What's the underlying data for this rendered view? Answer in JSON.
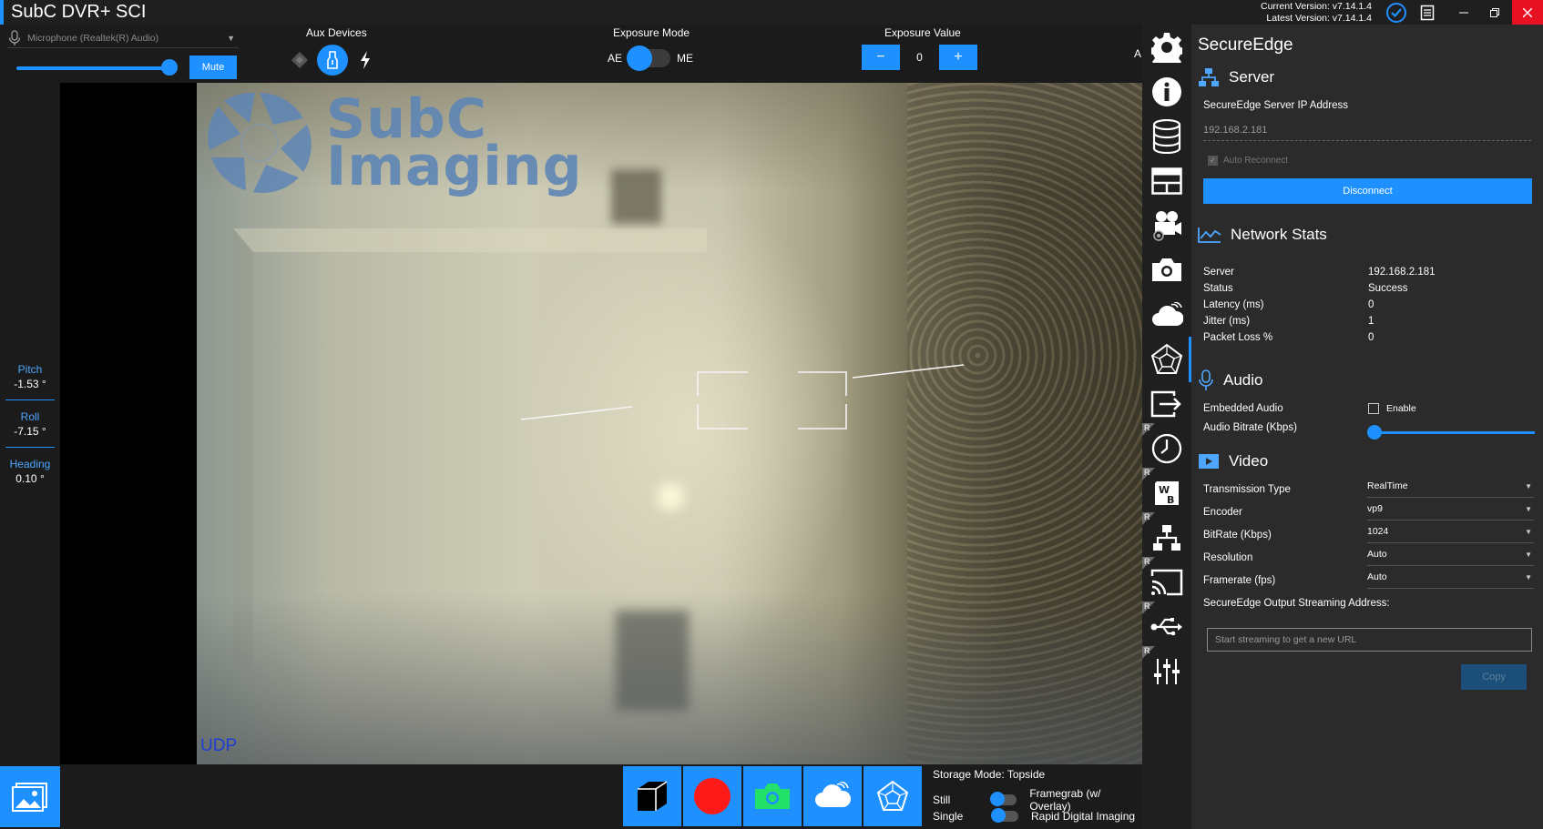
{
  "app": {
    "title": "SubC DVR+ SCI",
    "current_version": "Current Version: v7.14.1.4",
    "latest_version": "Latest Version: v7.14.1.4"
  },
  "audio_input": {
    "device": "Microphone (Realtek(R) Audio)",
    "mute_label": "Mute",
    "volume_level": 1.0
  },
  "aux_devices": {
    "label": "Aux Devices"
  },
  "exposure": {
    "mode_label": "Exposure Mode",
    "ae_label": "AE",
    "me_label": "ME",
    "value_label": "Exposure Value",
    "minus": "−",
    "plus": "+",
    "value": "0",
    "clipped_label": "A"
  },
  "telemetry": {
    "pitch_label": "Pitch",
    "pitch_value": "-1.53 °",
    "roll_label": "Roll",
    "roll_value": "-7.15 °",
    "heading_label": "Heading",
    "heading_value": "0.10 °"
  },
  "video": {
    "logo_line1": "SubC",
    "logo_line2": "Imaging",
    "protocol": "UDP"
  },
  "capture": {
    "storage_mode": "Storage Mode: Topside",
    "still_label": "Still",
    "still_option": "Framegrab (w/ Overlay)",
    "single_label": "Single",
    "single_option": "Rapid Digital Imaging"
  },
  "rail": {
    "icons": [
      "gear-icon",
      "info-icon",
      "database-icon",
      "layout-icon",
      "camera-settings-icon",
      "camera-icon",
      "cloud-icon",
      "secureedge-icon",
      "export-icon",
      "clock-icon",
      "white-balance-icon",
      "network-icon",
      "cast-icon",
      "usb-icon",
      "sliders-icon"
    ],
    "r_badge": "R"
  },
  "panel": {
    "title": "SecureEdge",
    "server": {
      "heading": "Server",
      "ip_label": "SecureEdge Server IP Address",
      "ip_value": "192.168.2.181",
      "auto_reconnect": "Auto Reconnect",
      "disconnect": "Disconnect"
    },
    "network": {
      "heading": "Network Stats",
      "rows": [
        {
          "label": "Server",
          "value": "192.168.2.181"
        },
        {
          "label": "Status",
          "value": "Success"
        },
        {
          "label": "Latency (ms)",
          "value": "0"
        },
        {
          "label": "Jitter (ms)",
          "value": "1"
        },
        {
          "label": "Packet Loss %",
          "value": "0"
        }
      ]
    },
    "audio": {
      "heading": "Audio",
      "embedded_label": "Embedded Audio",
      "enable_label": "Enable",
      "bitrate_label": "Audio Bitrate (Kbps)"
    },
    "video": {
      "heading": "Video",
      "fields": [
        {
          "label": "Transmission Type",
          "value": "RealTime"
        },
        {
          "label": "Encoder",
          "value": "vp9"
        },
        {
          "label": "BitRate (Kbps)",
          "value": "1024"
        },
        {
          "label": "Resolution",
          "value": "Auto"
        },
        {
          "label": "Framerate (fps)",
          "value": "Auto"
        }
      ],
      "output_label": "SecureEdge Output Streaming Address:",
      "url_placeholder": "Start streaming to get a new URL",
      "copy_label": "Copy"
    }
  },
  "colors": {
    "accent": "#1e90ff",
    "close": "#e81123",
    "record": "#ff1a1a",
    "snapshot": "#22e06a"
  }
}
